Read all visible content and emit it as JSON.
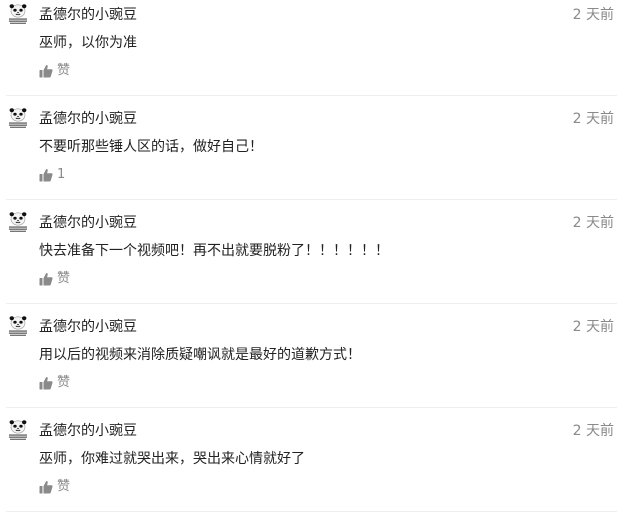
{
  "comments": [
    {
      "username": "孟德尔的小豌豆",
      "time": "2 天前",
      "content": "巫师，以你为准",
      "like": "赞"
    },
    {
      "username": "孟德尔的小豌豆",
      "time": "2 天前",
      "content": "不要听那些锤人区的话，做好自己！",
      "like": "1"
    },
    {
      "username": "孟德尔的小豌豆",
      "time": "2 天前",
      "content": "快去准备下一个视频吧！再不出就要脱粉了！！！！！！",
      "like": "赞"
    },
    {
      "username": "孟德尔的小豌豆",
      "time": "2 天前",
      "content": "用以后的视频来消除质疑嘲讽就是最好的道歉方式！",
      "like": "赞"
    },
    {
      "username": "孟德尔的小豌豆",
      "time": "2 天前",
      "content": "巫师，你难过就哭出来，哭出来心情就好了",
      "like": "赞"
    }
  ],
  "icons": {
    "avatar": "meme-panda-avatar",
    "like": "thumbs-up-icon"
  },
  "colors": {
    "text": "#222222",
    "meta": "#8a8a8a",
    "divider": "#eeeeee"
  }
}
